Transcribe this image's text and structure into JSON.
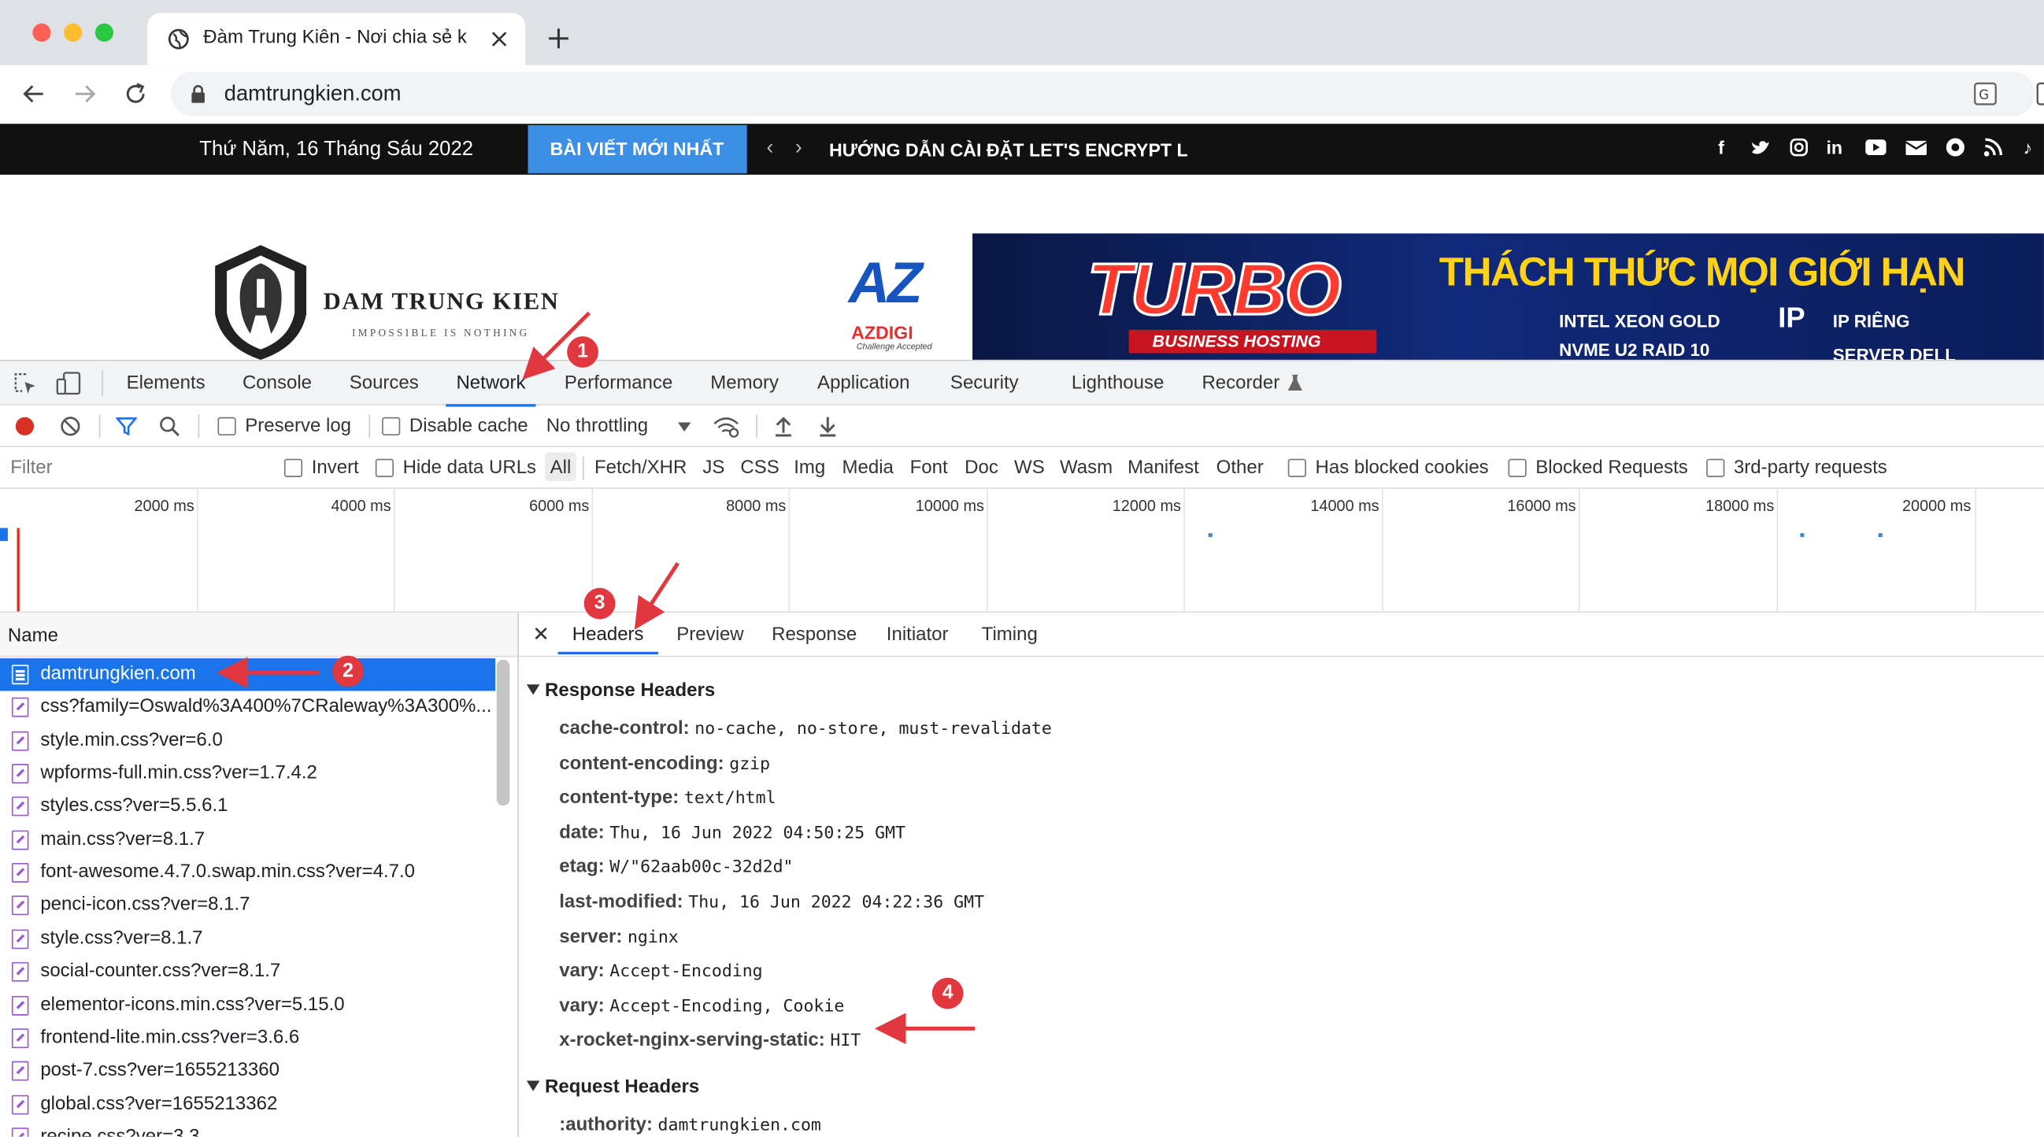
{
  "browser": {
    "tab_title": "Đàm Trung Kiên - Nơi chia sẻ k",
    "url": "damtrungkien.com"
  },
  "site": {
    "date": "Thứ Năm, 16 Tháng Sáu 2022",
    "latest_button": "BÀI VIẾT MỚI NHẤT",
    "headline": "HƯỚNG DẪN CÀI ĐẶT LET'S ENCRYPT LÊ",
    "logo_name": "DAM TRUNG KIEN",
    "logo_tagline": "IMPOSSIBLE IS NOTHING",
    "ad": {
      "brand": "AZDIGI",
      "brand_short": "AZ",
      "brand_tagline": "Challenge Accepted",
      "turbo": "TURBO",
      "business": "BUSINESS HOSTING",
      "slogan": "THÁCH THỨC MỌI GIỚI HẠN",
      "feature1": "INTEL XEON GOLD",
      "feature2": "NVME U2 RAID 10",
      "feature3": "IP RIÊNG",
      "feature4": "SERVER DELL"
    }
  },
  "devtools": {
    "tabs": [
      "Elements",
      "Console",
      "Sources",
      "Network",
      "Performance",
      "Memory",
      "Application",
      "Security",
      "Lighthouse",
      "Recorder"
    ],
    "active_tab": "Network",
    "preserve_log": "Preserve log",
    "disable_cache": "Disable cache",
    "throttling": "No throttling",
    "filter_placeholder": "Filter",
    "invert": "Invert",
    "hide_data_urls": "Hide data URLs",
    "types": [
      "All",
      "Fetch/XHR",
      "JS",
      "CSS",
      "Img",
      "Media",
      "Font",
      "Doc",
      "WS",
      "Wasm",
      "Manifest",
      "Other"
    ],
    "blocked_cookies": "Has blocked cookies",
    "blocked_requests": "Blocked Requests",
    "third_party": "3rd-party requests",
    "ticks": [
      "2000 ms",
      "4000 ms",
      "6000 ms",
      "8000 ms",
      "10000 ms",
      "12000 ms",
      "14000 ms",
      "16000 ms",
      "18000 ms",
      "20000 ms"
    ],
    "name_header": "Name",
    "requests": [
      "damtrungkien.com",
      "css?family=Oswald%3A400%7CRaleway%3A300%...",
      "style.min.css?ver=6.0",
      "wpforms-full.min.css?ver=1.7.4.2",
      "styles.css?ver=5.5.6.1",
      "main.css?ver=8.1.7",
      "font-awesome.4.7.0.swap.min.css?ver=4.7.0",
      "penci-icon.css?ver=8.1.7",
      "style.css?ver=8.1.7",
      "social-counter.css?ver=8.1.7",
      "elementor-icons.min.css?ver=5.15.0",
      "frontend-lite.min.css?ver=3.6.6",
      "post-7.css?ver=1655213360",
      "global.css?ver=1655213362",
      "recipe.css?ver=3.3"
    ],
    "detail_tabs": [
      "Headers",
      "Preview",
      "Response",
      "Initiator",
      "Timing"
    ],
    "response_title": "Response Headers",
    "response_headers": [
      {
        "k": "cache-control:",
        "v": "no-cache, no-store, must-revalidate"
      },
      {
        "k": "content-encoding:",
        "v": "gzip"
      },
      {
        "k": "content-type:",
        "v": "text/html"
      },
      {
        "k": "date:",
        "v": "Thu, 16 Jun 2022 04:50:25 GMT"
      },
      {
        "k": "etag:",
        "v": "W/\"62aab00c-32d2d\""
      },
      {
        "k": "last-modified:",
        "v": "Thu, 16 Jun 2022 04:22:36 GMT"
      },
      {
        "k": "server:",
        "v": "nginx"
      },
      {
        "k": "vary:",
        "v": "Accept-Encoding"
      },
      {
        "k": "vary:",
        "v": "Accept-Encoding, Cookie"
      },
      {
        "k": "x-rocket-nginx-serving-static:",
        "v": "HIT"
      }
    ],
    "request_title": "Request Headers",
    "request_headers": [
      {
        "k": ":authority:",
        "v": "damtrungkien.com"
      }
    ]
  },
  "annotations": [
    "1",
    "2",
    "3",
    "4"
  ],
  "colors": {
    "accent": "#1a73e8",
    "annotation": "#e0383e",
    "site_button": "#3d8fe6"
  }
}
